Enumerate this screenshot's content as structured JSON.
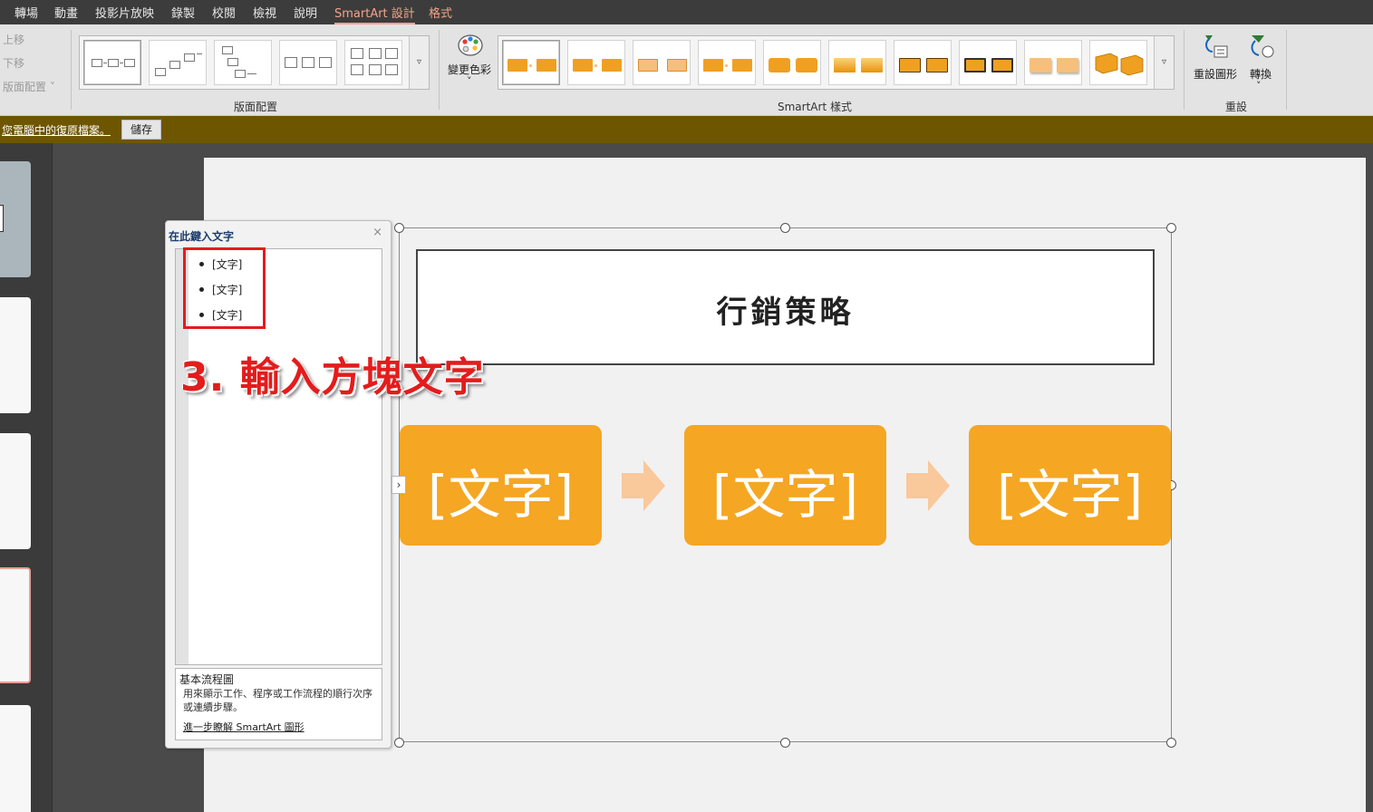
{
  "tabs": [
    {
      "label": "轉場",
      "state": "normal"
    },
    {
      "label": "動畫",
      "state": "normal"
    },
    {
      "label": "投影片放映",
      "state": "normal"
    },
    {
      "label": "錄製",
      "state": "normal"
    },
    {
      "label": "校閱",
      "state": "normal"
    },
    {
      "label": "檢視",
      "state": "normal"
    },
    {
      "label": "說明",
      "state": "normal"
    },
    {
      "label": "SmartArt 設計",
      "state": "active"
    },
    {
      "label": "格式",
      "state": "accent"
    }
  ],
  "ribbon": {
    "create_graphic": {
      "move_up": "上移",
      "move_down": "下移",
      "layout_dir": "版面配置 ˅"
    },
    "layouts": {
      "label": "版面配置",
      "thumb_count": 5
    },
    "styles": {
      "change_colors": "變更色彩",
      "label": "SmartArt 樣式",
      "thumb_count": 10
    },
    "reset": {
      "reset_graphic": "重設圖形",
      "convert": "轉換",
      "label": "重設"
    },
    "gallery_more_icon": "▿",
    "dropdown_icon": "˅"
  },
  "message_bar": {
    "link": "您電腦中的復原檔案。",
    "save_button": "儲存"
  },
  "text_pane": {
    "title": "在此鍵入文字",
    "close_icon": "×",
    "items": [
      "[文字]",
      "[文字]",
      "[文字]"
    ],
    "description_title": "基本流程圖",
    "description_body": "用來顯示工作、程序或工作流程的順行次序或連續步驟。",
    "learn_more": "進一步瞭解 SmartArt 圖形",
    "toggle_icon": "›"
  },
  "slide": {
    "title": "行銷策略",
    "process_boxes": [
      "[文字]",
      "[文字]",
      "[文字]"
    ]
  },
  "annotation": {
    "text": "3. 輸入方塊文字"
  },
  "colors": {
    "accent_orange": "#F5A623",
    "arrow_peach": "#F9C89B",
    "annotation_red": "#E31C1C",
    "message_bar": "#6E5600",
    "tab_active": "#F4A48A"
  }
}
